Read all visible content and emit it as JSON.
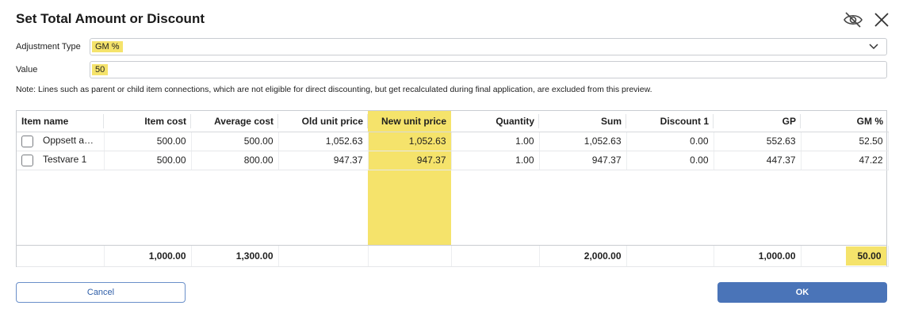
{
  "dialog": {
    "title": "Set Total Amount or Discount",
    "icons": [
      "eye-off-icon",
      "close-icon"
    ]
  },
  "adjustment_type": {
    "label": "Adjustment Type",
    "value": "GM %"
  },
  "value_field": {
    "label": "Value",
    "value": "50"
  },
  "note": "Note: Lines such as parent or child item connections, which are not eligible for direct discounting, but get recalculated during final application, are excluded from this preview.",
  "table": {
    "columns": [
      "Item name",
      "Item cost",
      "Average cost",
      "Old unit price",
      "New unit price",
      "Quantity",
      "Sum",
      "Discount 1",
      "GP",
      "GM %"
    ],
    "rows": [
      [
        "Oppsett a…",
        "500.00",
        "500.00",
        "1,052.63",
        "1,052.63",
        "1.00",
        "1,052.63",
        "0.00",
        "552.63",
        "52.50"
      ],
      [
        "Testvare 1",
        "500.00",
        "800.00",
        "947.37",
        "947.37",
        "1.00",
        "947.37",
        "0.00",
        "447.37",
        "47.22"
      ]
    ],
    "totals": {
      "item_cost": "1,000.00",
      "average_cost": "1,300.00",
      "sum": "2,000.00",
      "gp": "1,000.00",
      "gm": "50.00"
    }
  },
  "buttons": {
    "cancel": "Cancel",
    "ok": "OK"
  },
  "colors": {
    "highlight": "#f5e36b",
    "primary": "#4a74b8"
  }
}
